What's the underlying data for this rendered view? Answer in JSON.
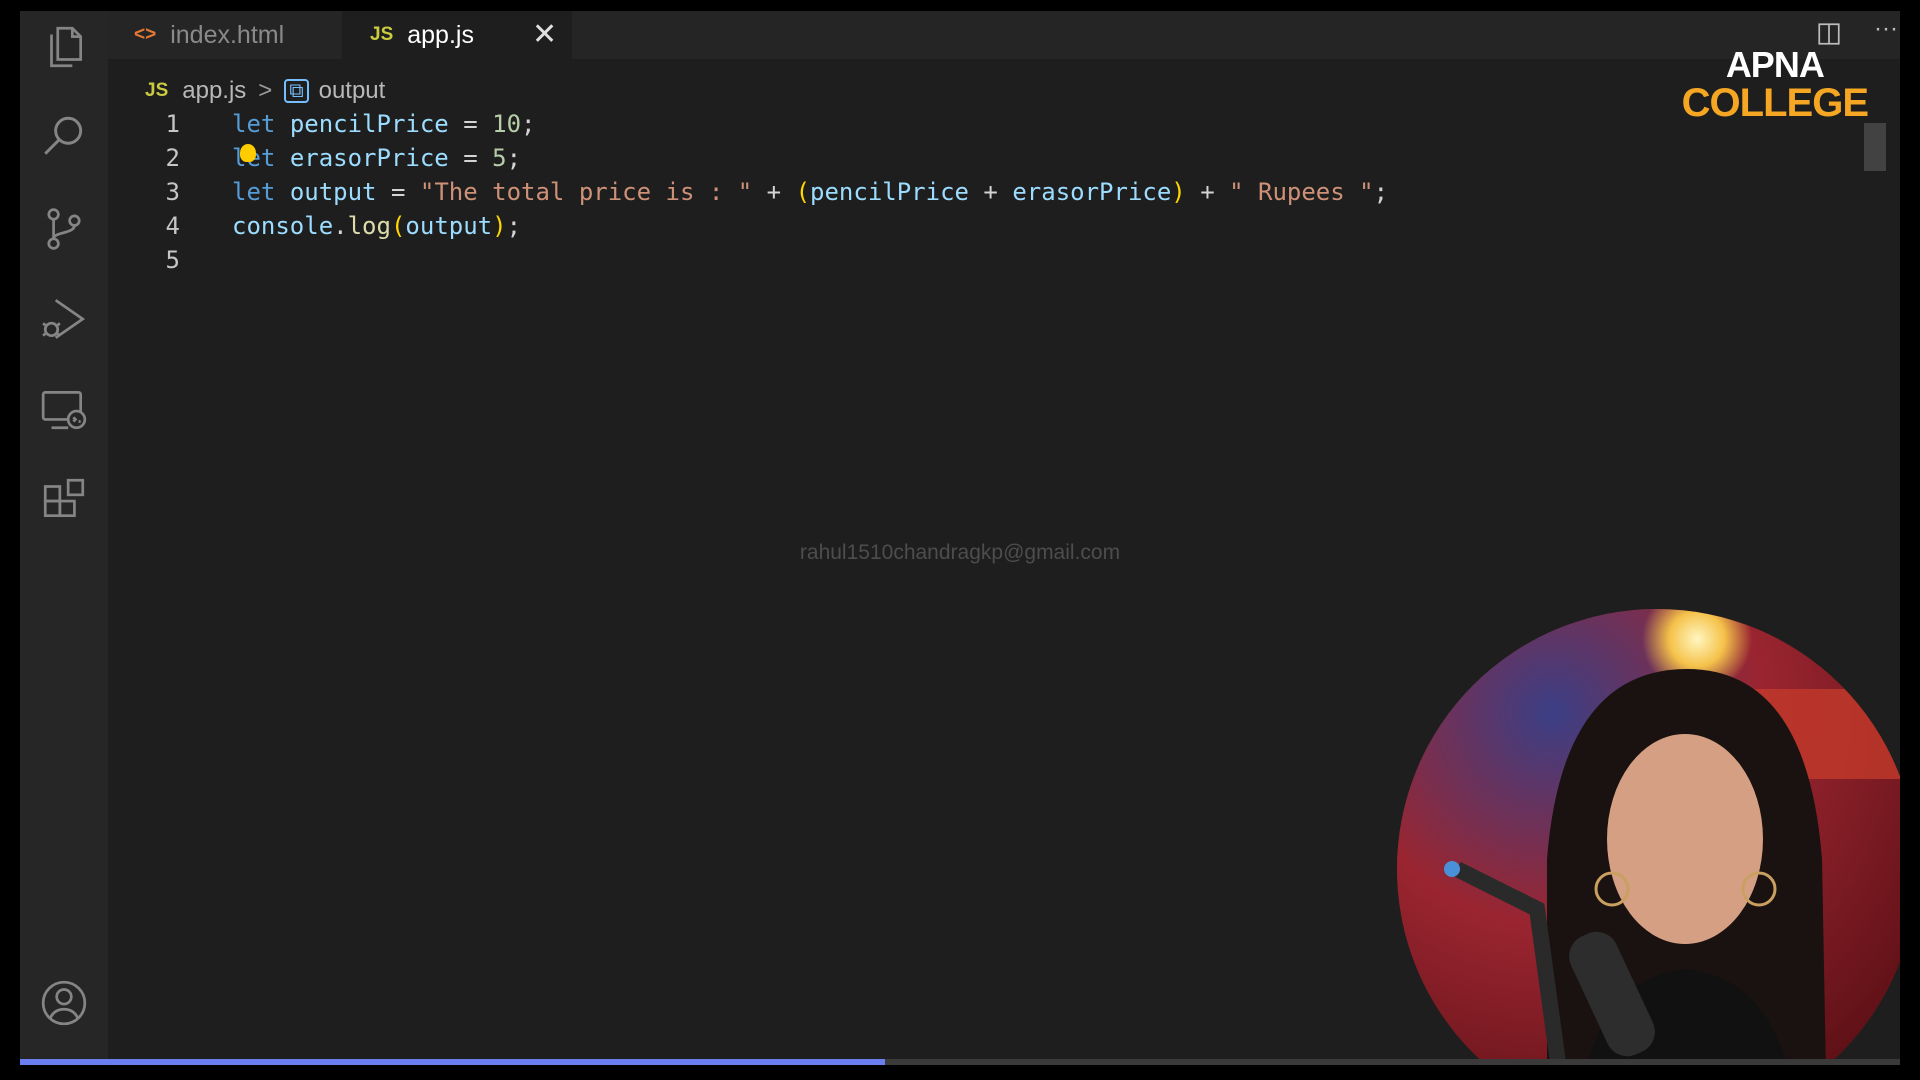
{
  "tabs": [
    {
      "icon": "<>",
      "label": "index.html",
      "active": false
    },
    {
      "icon": "JS",
      "label": "app.js",
      "active": true
    }
  ],
  "tab_close": "✕",
  "top_actions": {
    "more": "···"
  },
  "breadcrumb": {
    "file_icon": "JS",
    "file": "app.js",
    "separator": ">",
    "symbol_icon": "⧉",
    "symbol": "output"
  },
  "code_lines": [
    {
      "num": "1",
      "tokens": [
        [
          "kw",
          "let"
        ],
        [
          "pun",
          " "
        ],
        [
          "var",
          "pencilPrice"
        ],
        [
          "pun",
          " = "
        ],
        [
          "num",
          "10"
        ],
        [
          "pun",
          ";"
        ]
      ]
    },
    {
      "num": "2",
      "tokens": [
        [
          "kw",
          "let"
        ],
        [
          "pun",
          " "
        ],
        [
          "var",
          "erasorPrice"
        ],
        [
          "pun",
          " = "
        ],
        [
          "num",
          "5"
        ],
        [
          "pun",
          ";"
        ]
      ]
    },
    {
      "num": "3",
      "tokens": [
        [
          "kw",
          "let"
        ],
        [
          "pun",
          " "
        ],
        [
          "var",
          "output"
        ],
        [
          "pun",
          " = "
        ],
        [
          "str",
          "\"The total price is : \""
        ],
        [
          "pun",
          " + "
        ],
        [
          "br",
          "("
        ],
        [
          "var",
          "pencilPrice"
        ],
        [
          "pun",
          " + "
        ],
        [
          "var",
          "erasorPrice"
        ],
        [
          "br",
          ")"
        ],
        [
          "pun",
          " + "
        ],
        [
          "str",
          "\" Rupees \""
        ],
        [
          "pun",
          ";"
        ]
      ]
    },
    {
      "num": "4",
      "tokens": [
        [
          "var",
          "console"
        ],
        [
          "pun",
          "."
        ],
        [
          "fn",
          "log"
        ],
        [
          "br",
          "("
        ],
        [
          "var",
          "output"
        ],
        [
          "br",
          ")"
        ],
        [
          "pun",
          ";"
        ]
      ]
    },
    {
      "num": "5",
      "tokens": []
    }
  ],
  "watermark": "rahul1510chandragkp@gmail.com",
  "logo": {
    "line1": "APNA",
    "line2": "COLLEGE"
  },
  "activity_bar": [
    "files-icon",
    "search-icon",
    "source-control-icon",
    "run-debug-icon",
    "remote-explorer-icon",
    "extensions-icon",
    "account-icon"
  ],
  "colors": {
    "keyword": "#569cd6",
    "variable": "#9cdcfe",
    "number": "#b5cea8",
    "string": "#ce9178",
    "function": "#dcdcaa",
    "bracket": "#ffd700",
    "accent": "#6a7ef0"
  },
  "video_progress": 0.46
}
